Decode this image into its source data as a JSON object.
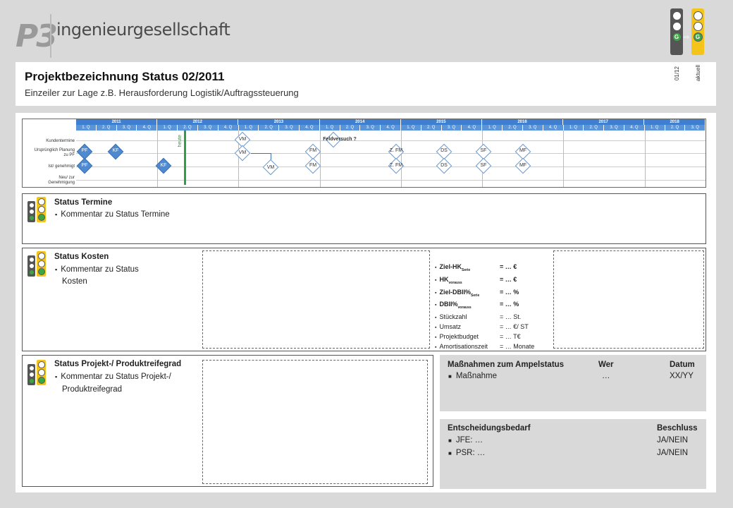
{
  "logo": {
    "mark": "P3",
    "text": "ingenieurgesellschaft"
  },
  "lights": {
    "previous_label": "01/12",
    "current_label": "aktuell",
    "lamp_letter": "G"
  },
  "title": "Projektbezeichnung  Status 02/2011",
  "subtitle": "Einzeiler zur Lage z.B. Herausforderung Logistik/Auftragssteuerung",
  "gantt": {
    "years": [
      "2011",
      "2012",
      "2013",
      "2014",
      "2015",
      "2016",
      "2017",
      "2018"
    ],
    "quarters": [
      "1. Q",
      "2. Q",
      "3. Q",
      "4. Q"
    ],
    "last_year_quarters": [
      "1. Q",
      "2. Q",
      "3. Q"
    ],
    "rows": [
      "Kundentermine",
      "Ursprünglich Planung zu PF",
      "Ist/ genehmigt",
      "Neu/ zur Genehmigung"
    ],
    "today_label": "heute",
    "milestones": {
      "kunde_vm": "VM",
      "feldversuch": "Feldversuch ?",
      "plan": [
        "PF",
        "KF",
        "VM",
        "FM",
        "Z. FM",
        "DS",
        "SF",
        "MF"
      ],
      "ist": [
        "PF",
        "KF",
        "VM",
        "FM",
        "Z. FM",
        "DS",
        "SF",
        "MF"
      ]
    }
  },
  "termine": {
    "title": "Status Termine",
    "comment": "Kommentar zu Status Termine"
  },
  "kosten": {
    "title": "Status Kosten",
    "comment_line1": "Kommentar zu Status",
    "comment_line2": "Kosten",
    "kpis": [
      {
        "label": "Ziel-HK",
        "sub": "Serie",
        "value": "= … €",
        "bold": true
      },
      {
        "label": "HK",
        "sub": "vorauss",
        "value": "= … €",
        "bold": true
      },
      {
        "label": "Ziel-DBII%",
        "sub": "Serie",
        "value": "= … %",
        "bold": true
      },
      {
        "label": "DBII%",
        "sub": "vorauss",
        "value": "= … %",
        "bold": true
      },
      {
        "label": "Stückzahl",
        "sub": "",
        "value": "= … St.",
        "bold": false
      },
      {
        "label": "Umsatz",
        "sub": "",
        "value": "= … €/ ST",
        "bold": false
      },
      {
        "label": "Projektbudget",
        "sub": "",
        "value": "= … T€",
        "bold": false
      },
      {
        "label": "Amortisationszeit",
        "sub": "",
        "value": "= … Monate",
        "bold": false
      }
    ]
  },
  "reife": {
    "title": "Status Projekt-/ Produktreifegrad",
    "comment_line1": "Kommentar zu Status Projekt-/",
    "comment_line2": "Produktreifegrad"
  },
  "massnahmen": {
    "col1": "Maßnahmen zum Ampelstatus",
    "col2": "Wer",
    "col3": "Datum",
    "item": "Maßnahme",
    "wer": "…",
    "datum": "XX/YY"
  },
  "entscheidung": {
    "col1": "Entscheidungsbedarf",
    "col2": "Beschluss",
    "items": [
      {
        "label": "JFE: …",
        "value": "JA/NEIN"
      },
      {
        "label": "PSR: …",
        "value": "JA/NEIN"
      }
    ]
  }
}
